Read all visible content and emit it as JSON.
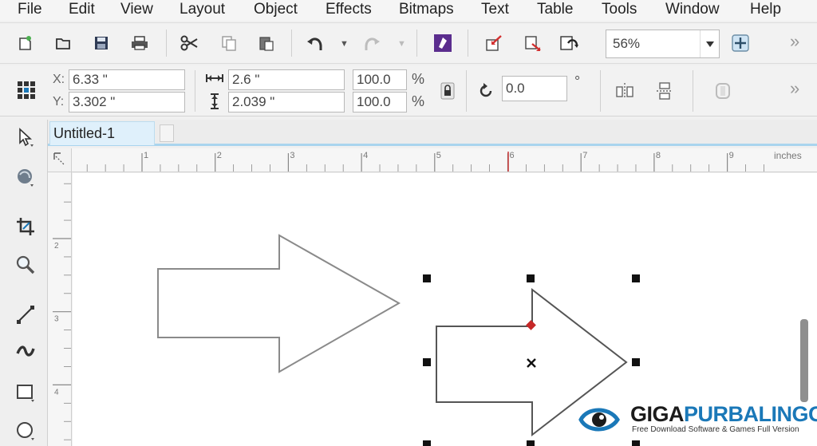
{
  "menu": [
    "File",
    "Edit",
    "View",
    "Layout",
    "Object",
    "Effects",
    "Bitmaps",
    "Text",
    "Table",
    "Tools",
    "Window",
    "Help"
  ],
  "toolbar": {
    "zoom_value": "56%",
    "more_label": "»",
    "buttons": [
      "new-icon",
      "open-icon",
      "save-icon",
      "print-icon",
      "cut-icon",
      "copy-icon",
      "paste-icon",
      "undo-icon",
      "redo-icon",
      "search-content-icon",
      "import-icon",
      "export-icon",
      "publish-pdf-icon",
      "snap-to-icon"
    ]
  },
  "propbar": {
    "x_label": "X:",
    "x_value": "6.33 \"",
    "y_label": "Y:",
    "y_value": "3.302 \"",
    "w_value": "2.6 \"",
    "h_value": "2.039 \"",
    "scale_w": "100.0",
    "scale_h": "100.0",
    "pct_symbol": "%",
    "rotation": "0.0",
    "degree_symbol": "°",
    "more_label": "»"
  },
  "document": {
    "tab_title": "Untitled-1"
  },
  "ruler": {
    "unit": "inches",
    "h_ticks": [
      "1",
      "2",
      "3",
      "4",
      "5",
      "6",
      "7",
      "8",
      "9"
    ],
    "v_ticks": [
      "2",
      "3",
      "4"
    ]
  },
  "tools": [
    "pick-tool-icon",
    "shape-tool-icon",
    "crop-tool-icon",
    "zoom-tool-icon",
    "freehand-tool-icon",
    "artistic-media-icon",
    "rectangle-tool-icon",
    "ellipse-tool-icon"
  ],
  "watermark": {
    "brand_part1": "GIGA",
    "brand_part2": "PURBALINGGA",
    "tagline": "Free Download Software & Games Full Version"
  },
  "colors": {
    "accent": "#1a78b8",
    "tab_underline": "#a9d4ee",
    "node_red": "#c62828"
  }
}
